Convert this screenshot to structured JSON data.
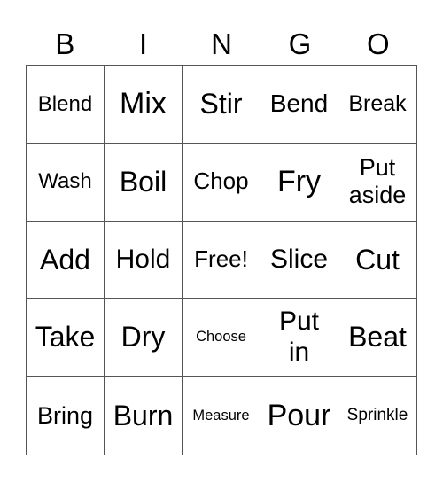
{
  "header": [
    "B",
    "I",
    "N",
    "G",
    "O"
  ],
  "cells": [
    "Blend",
    "Mix",
    "Stir",
    "Bend",
    "Break",
    "Wash",
    "Boil",
    "Chop",
    "Fry",
    "Put\naside",
    "Add",
    "Hold",
    "Free!",
    "Slice",
    "Cut",
    "Take",
    "Dry",
    "Choose",
    "Put\nin",
    "Beat",
    "Bring",
    "Burn",
    "Measure",
    "Pour",
    "Sprinkle"
  ]
}
